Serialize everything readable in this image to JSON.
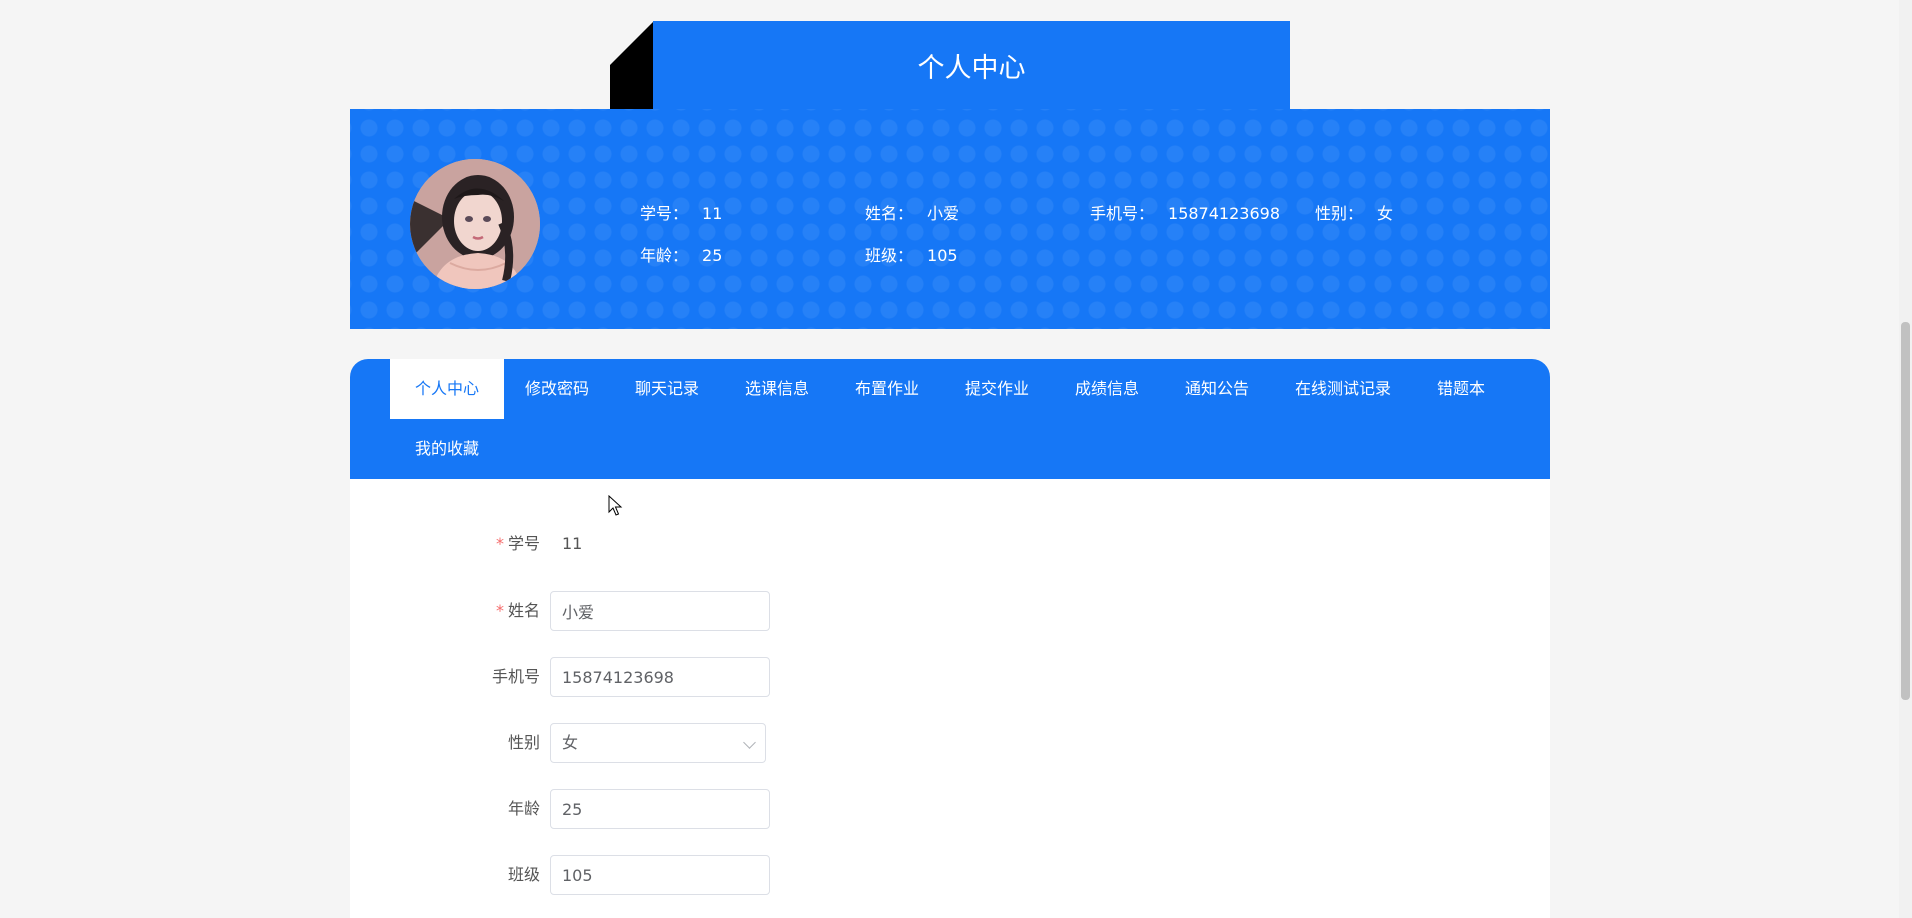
{
  "header": {
    "title": "个人中心"
  },
  "profile": {
    "student_id": {
      "label": "学号：",
      "value": "11"
    },
    "name": {
      "label": "姓名：",
      "value": "小爱"
    },
    "phone": {
      "label": "手机号：",
      "value": "15874123698"
    },
    "gender": {
      "label": "性别：",
      "value": "女"
    },
    "age": {
      "label": "年龄：",
      "value": "25"
    },
    "class": {
      "label": "班级：",
      "value": "105"
    }
  },
  "tabs": [
    {
      "label": "个人中心",
      "active": true
    },
    {
      "label": "修改密码"
    },
    {
      "label": "聊天记录"
    },
    {
      "label": "选课信息"
    },
    {
      "label": "布置作业"
    },
    {
      "label": "提交作业"
    },
    {
      "label": "成绩信息"
    },
    {
      "label": "通知公告"
    },
    {
      "label": "在线测试记录"
    },
    {
      "label": "错题本"
    },
    {
      "label": "我的收藏"
    }
  ],
  "form": {
    "student_id": {
      "label": "学号",
      "required": true,
      "value": "11"
    },
    "name": {
      "label": "姓名",
      "required": true,
      "value": "小爱"
    },
    "phone": {
      "label": "手机号",
      "value": "15874123698"
    },
    "gender": {
      "label": "性别",
      "value": "女"
    },
    "age": {
      "label": "年龄",
      "value": "25"
    },
    "class": {
      "label": "班级",
      "value": "105"
    }
  },
  "colors": {
    "primary": "#1677f6",
    "required": "#f56c6c",
    "page_bg": "#f5f5f5"
  }
}
